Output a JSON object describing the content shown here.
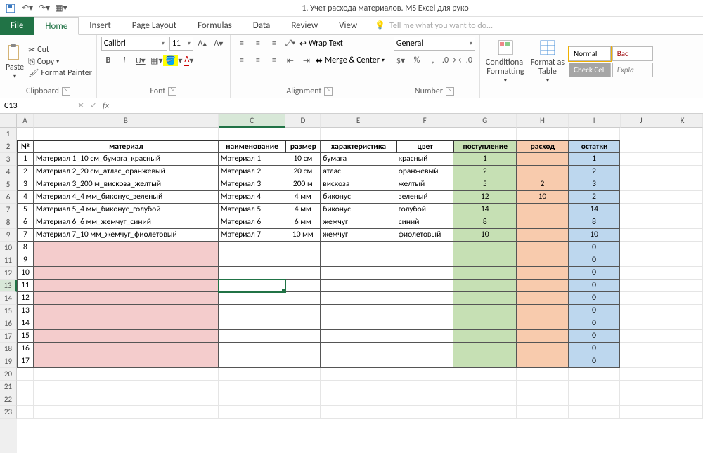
{
  "title": "1. Учет расхода материалов. MS Excel для руко",
  "tabs": {
    "file": "File",
    "home": "Home",
    "insert": "Insert",
    "pagelayout": "Page Layout",
    "formulas": "Formulas",
    "data": "Data",
    "review": "Review",
    "view": "View"
  },
  "tell_me": "Tell me what you want to do...",
  "clipboard": {
    "paste": "Paste",
    "cut": "Cut",
    "copy": "Copy",
    "painter": "Format Painter",
    "label": "Clipboard"
  },
  "font": {
    "name": "Calibri",
    "size": "11",
    "label": "Font"
  },
  "alignment": {
    "wrap": "Wrap Text",
    "merge": "Merge & Center",
    "label": "Alignment"
  },
  "number": {
    "format": "General",
    "label": "Number"
  },
  "styles": {
    "cond": "Conditional\nFormatting",
    "fmt_tbl": "Format as\nTable",
    "normal": "Normal",
    "bad": "Bad",
    "check": "Check Cell",
    "expl": "Expla"
  },
  "namebox": "C13",
  "cols": [
    "A",
    "B",
    "C",
    "D",
    "E",
    "F",
    "G",
    "H",
    "I",
    "J",
    "K"
  ],
  "widths": {
    "A": 24,
    "B": 264,
    "C": 96,
    "D": 50,
    "E": 108,
    "F": 82,
    "G": 90,
    "H": 74,
    "I": 74,
    "J": 60,
    "K": 58
  },
  "chart_data": {
    "type": "table",
    "headers": {
      "A": "№",
      "B": "материал",
      "C": "наименование",
      "D": "размер",
      "E": "характеристика",
      "F": "цвет",
      "G": "поступление",
      "H": "расход",
      "I": "остатки"
    },
    "rows": [
      {
        "A": "1",
        "B": "Материал 1_10 см_бумага_красный",
        "C": "Материал 1",
        "D": "10 см",
        "E": "бумага",
        "F": "красный",
        "G": "1",
        "H": "",
        "I": "1"
      },
      {
        "A": "2",
        "B": "Материал 2_20 см_атлас_оранжевый",
        "C": "Материал 2",
        "D": "20 см",
        "E": "атлас",
        "F": "оранжевый",
        "G": "2",
        "H": "",
        "I": "2"
      },
      {
        "A": "3",
        "B": "Материал 3_200 м_вискоза_желтый",
        "C": "Материал 3",
        "D": "200 м",
        "E": "вискоза",
        "F": "желтый",
        "G": "5",
        "H": "2",
        "I": "3"
      },
      {
        "A": "4",
        "B": "Материал 4_4 мм_биконус_зеленый",
        "C": "Материал 4",
        "D": "4 мм",
        "E": "биконус",
        "F": "зеленый",
        "G": "12",
        "H": "10",
        "I": "2"
      },
      {
        "A": "5",
        "B": "Материал 5_4 мм_биконус_голубой",
        "C": "Материал 5",
        "D": "4 мм",
        "E": "биконус",
        "F": "голубой",
        "G": "14",
        "H": "",
        "I": "14"
      },
      {
        "A": "6",
        "B": "Материал 6_6 мм_жемчуг_синий",
        "C": "Материал 6",
        "D": "6 мм",
        "E": "жемчуг",
        "F": "синий",
        "G": "8",
        "H": "",
        "I": "8"
      },
      {
        "A": "7",
        "B": "Материал 7_10 мм_жемчуг_фиолетовый",
        "C": "Материал 7",
        "D": "10 мм",
        "E": "жемчуг",
        "F": "фиолетовый",
        "G": "10",
        "H": "",
        "I": "10"
      },
      {
        "A": "8",
        "B": "",
        "C": "",
        "D": "",
        "E": "",
        "F": "",
        "G": "",
        "H": "",
        "I": "0"
      },
      {
        "A": "9",
        "B": "",
        "C": "",
        "D": "",
        "E": "",
        "F": "",
        "G": "",
        "H": "",
        "I": "0"
      },
      {
        "A": "10",
        "B": "",
        "C": "",
        "D": "",
        "E": "",
        "F": "",
        "G": "",
        "H": "",
        "I": "0"
      },
      {
        "A": "11",
        "B": "",
        "C": "",
        "D": "",
        "E": "",
        "F": "",
        "G": "",
        "H": "",
        "I": "0"
      },
      {
        "A": "12",
        "B": "",
        "C": "",
        "D": "",
        "E": "",
        "F": "",
        "G": "",
        "H": "",
        "I": "0"
      },
      {
        "A": "13",
        "B": "",
        "C": "",
        "D": "",
        "E": "",
        "F": "",
        "G": "",
        "H": "",
        "I": "0"
      },
      {
        "A": "14",
        "B": "",
        "C": "",
        "D": "",
        "E": "",
        "F": "",
        "G": "",
        "H": "",
        "I": "0"
      },
      {
        "A": "15",
        "B": "",
        "C": "",
        "D": "",
        "E": "",
        "F": "",
        "G": "",
        "H": "",
        "I": "0"
      },
      {
        "A": "16",
        "B": "",
        "C": "",
        "D": "",
        "E": "",
        "F": "",
        "G": "",
        "H": "",
        "I": "0"
      },
      {
        "A": "17",
        "B": "",
        "C": "",
        "D": "",
        "E": "",
        "F": "",
        "G": "",
        "H": "",
        "I": "0"
      }
    ]
  },
  "rowcount": 23,
  "sel": {
    "row": 13,
    "col": "C"
  }
}
